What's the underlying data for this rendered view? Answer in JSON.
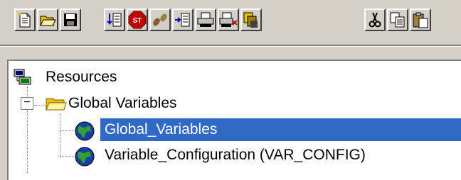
{
  "toolbar": {
    "buttons": [
      {
        "name": "new-file",
        "icon": "new-file-icon"
      },
      {
        "name": "open-folder",
        "icon": "open-folder-icon"
      },
      {
        "name": "save",
        "icon": "save-icon"
      },
      {
        "name": "list-down",
        "icon": "list-down-icon"
      },
      {
        "name": "stop",
        "icon": "stop-icon",
        "label": "ST"
      },
      {
        "name": "program-step",
        "icon": "footsteps-icon"
      },
      {
        "name": "insert-list",
        "icon": "insert-list-icon"
      },
      {
        "name": "print",
        "icon": "printer-icon"
      },
      {
        "name": "print-delete",
        "icon": "printer-delete-icon"
      },
      {
        "name": "copy-files",
        "icon": "copy-files-icon"
      },
      {
        "name": "cut",
        "icon": "scissors-icon"
      },
      {
        "name": "copy",
        "icon": "copy-icon"
      },
      {
        "name": "paste",
        "icon": "paste-icon"
      }
    ]
  },
  "tree": {
    "root": {
      "label": "Resources",
      "icon": "resources-icon"
    },
    "folder": {
      "label": "Global Variables",
      "icon": "folder-icon",
      "expander": "−"
    },
    "items": [
      {
        "label": "Global_Variables",
        "icon": "globe-icon",
        "selected": true
      },
      {
        "label": "Variable_Configuration (VAR_CONFIG)",
        "icon": "globe-icon",
        "selected": false
      }
    ]
  },
  "colors": {
    "selection": "#316ac5",
    "window_bg": "#d4d0c8"
  }
}
